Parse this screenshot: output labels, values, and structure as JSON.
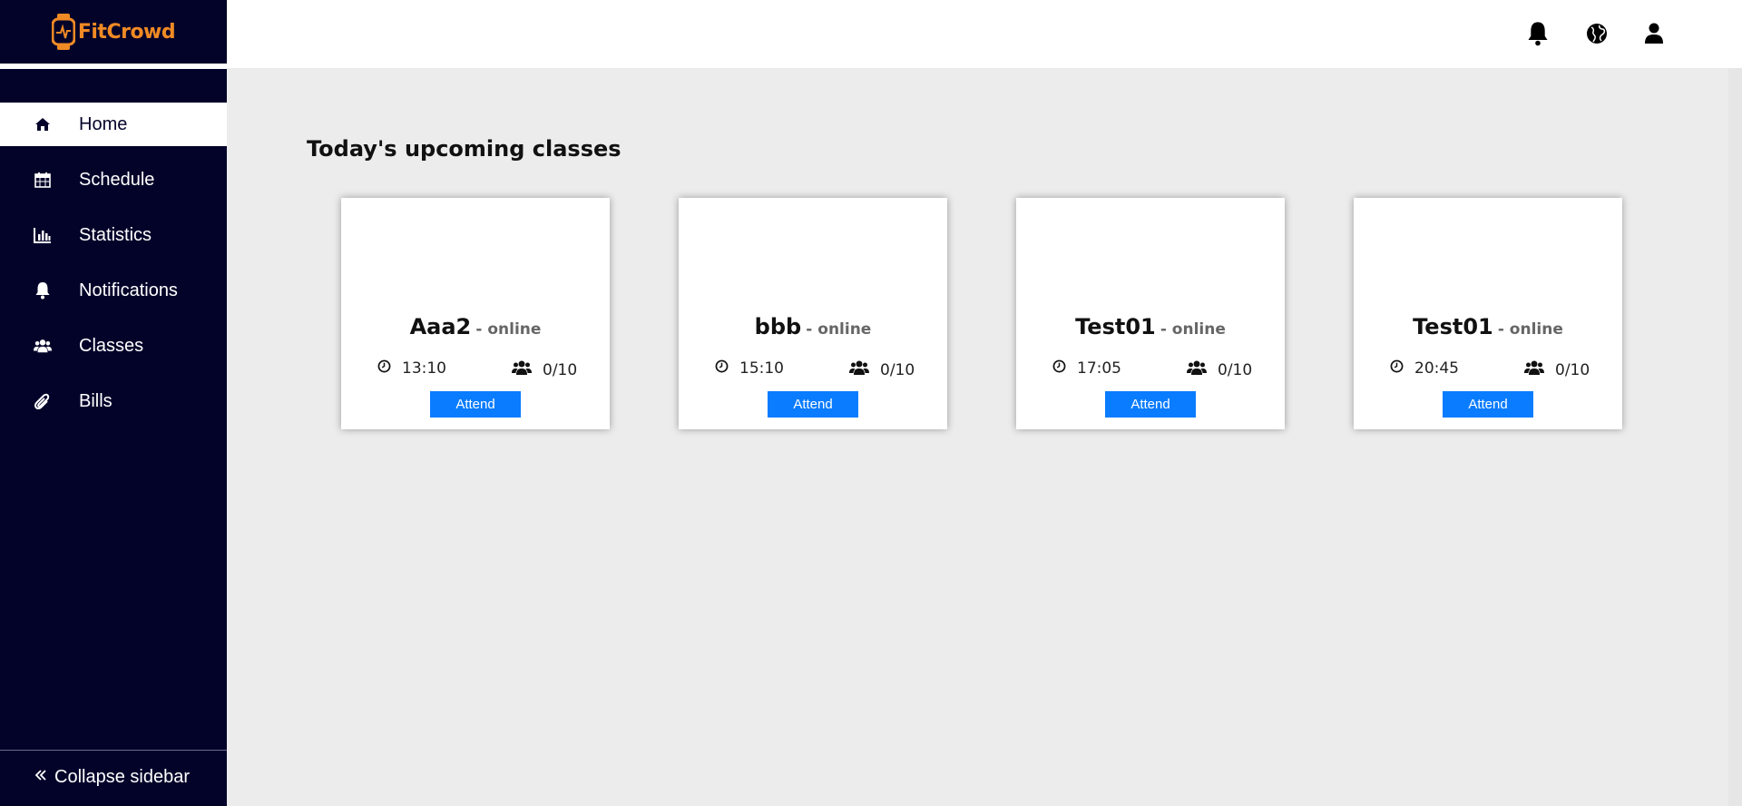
{
  "app": {
    "name": "FitCrowd",
    "brand_color": "#f08a24",
    "sidebar_color": "#03032a",
    "accent": "#0a7cff"
  },
  "sidebar": {
    "items": [
      {
        "label": "Home",
        "icon": "home-icon",
        "active": true
      },
      {
        "label": "Schedule",
        "icon": "calendar-icon",
        "active": false
      },
      {
        "label": "Statistics",
        "icon": "bar-chart-icon",
        "active": false
      },
      {
        "label": "Notifications",
        "icon": "bell-icon",
        "active": false
      },
      {
        "label": "Classes",
        "icon": "users-icon",
        "active": false
      },
      {
        "label": "Bills",
        "icon": "paperclip-icon",
        "active": false
      }
    ],
    "collapse_label": "Collapse sidebar"
  },
  "topbar": {
    "icons": [
      "bell-icon",
      "globe-icon",
      "user-icon"
    ]
  },
  "main": {
    "title": "Today's upcoming classes",
    "classes": [
      {
        "name": "Aaa2",
        "mode": "- online",
        "time": "13:10",
        "capacity": "0/10",
        "button": "Attend"
      },
      {
        "name": "bbb",
        "mode": "- online",
        "time": "15:10",
        "capacity": "0/10",
        "button": "Attend"
      },
      {
        "name": "Test01",
        "mode": "- online",
        "time": "17:05",
        "capacity": "0/10",
        "button": "Attend"
      },
      {
        "name": "Test01",
        "mode": "- online",
        "time": "20:45",
        "capacity": "0/10",
        "button": "Attend"
      }
    ]
  }
}
